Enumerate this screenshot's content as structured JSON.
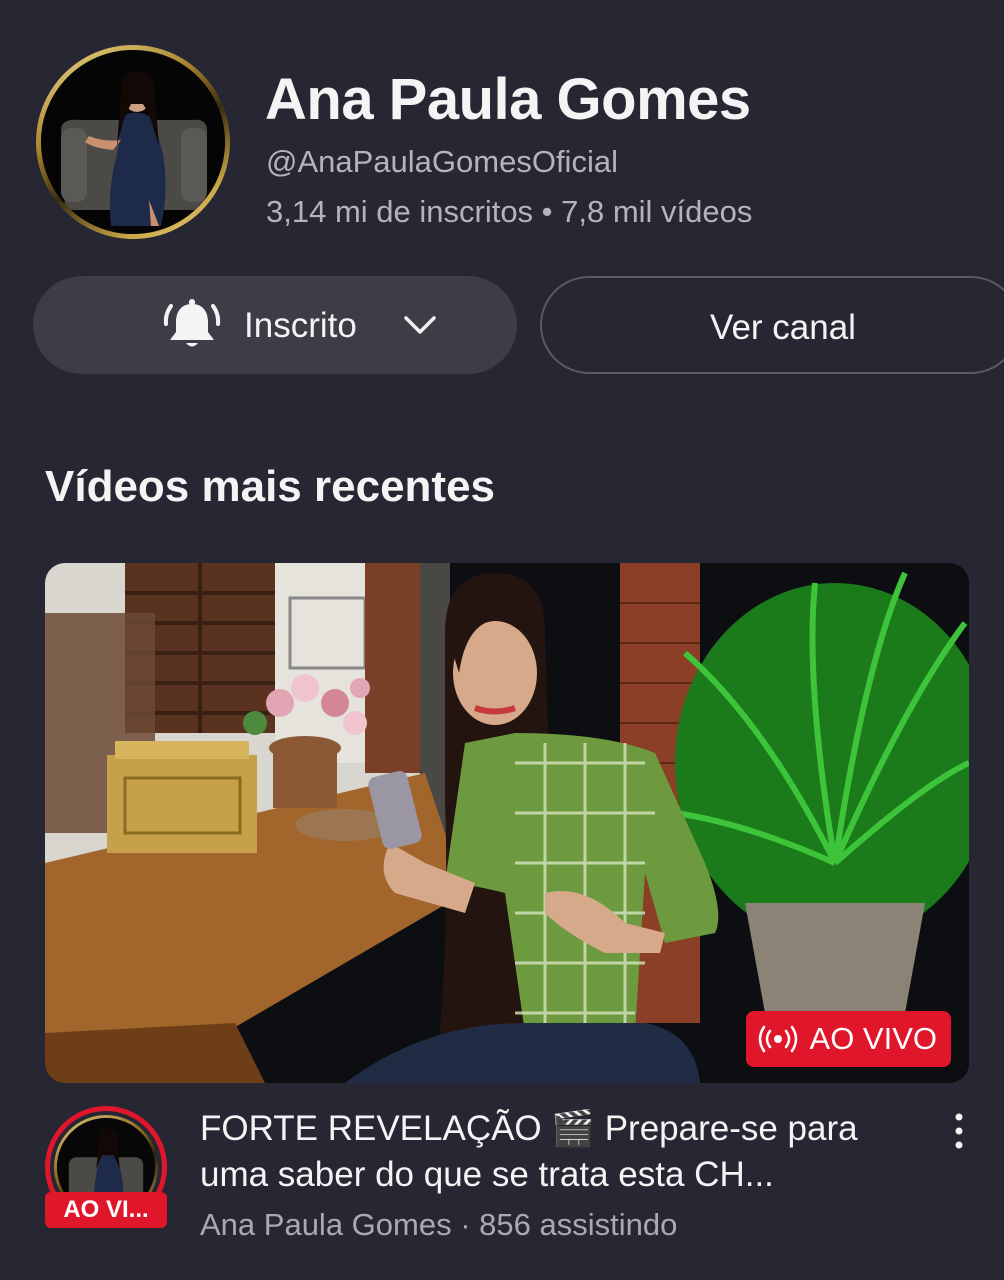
{
  "channel": {
    "name": "Ana Paula Gomes",
    "handle": "@AnaPaulaGomesOficial",
    "stats": "3,14 mi de inscritos • 7,8 mil vídeos",
    "avatar_icon": "profile-photo"
  },
  "actions": {
    "subscribed_label": "Inscrito",
    "bell_icon": "bell-icon",
    "chevron_icon": "chevron-down-icon",
    "view_channel_label": "Ver canal"
  },
  "section": {
    "title": "Vídeos mais recentes"
  },
  "video": {
    "live_badge_label": "AO VIVO",
    "live_icon": "live-broadcast-icon",
    "avatar_live_tag": "AO VI...",
    "title": "FORTE REVELAÇÃO 🎬 Prepare-se para uma saber do que se trata esta CH...",
    "channel_and_viewers": "Ana Paula Gomes · 856 assistindo",
    "more_icon": "more-vertical-icon"
  },
  "colors": {
    "background": "#272733",
    "button_bg": "#3d3d48",
    "live_red": "#e0162b",
    "secondary_text": "#b3b3bb"
  }
}
